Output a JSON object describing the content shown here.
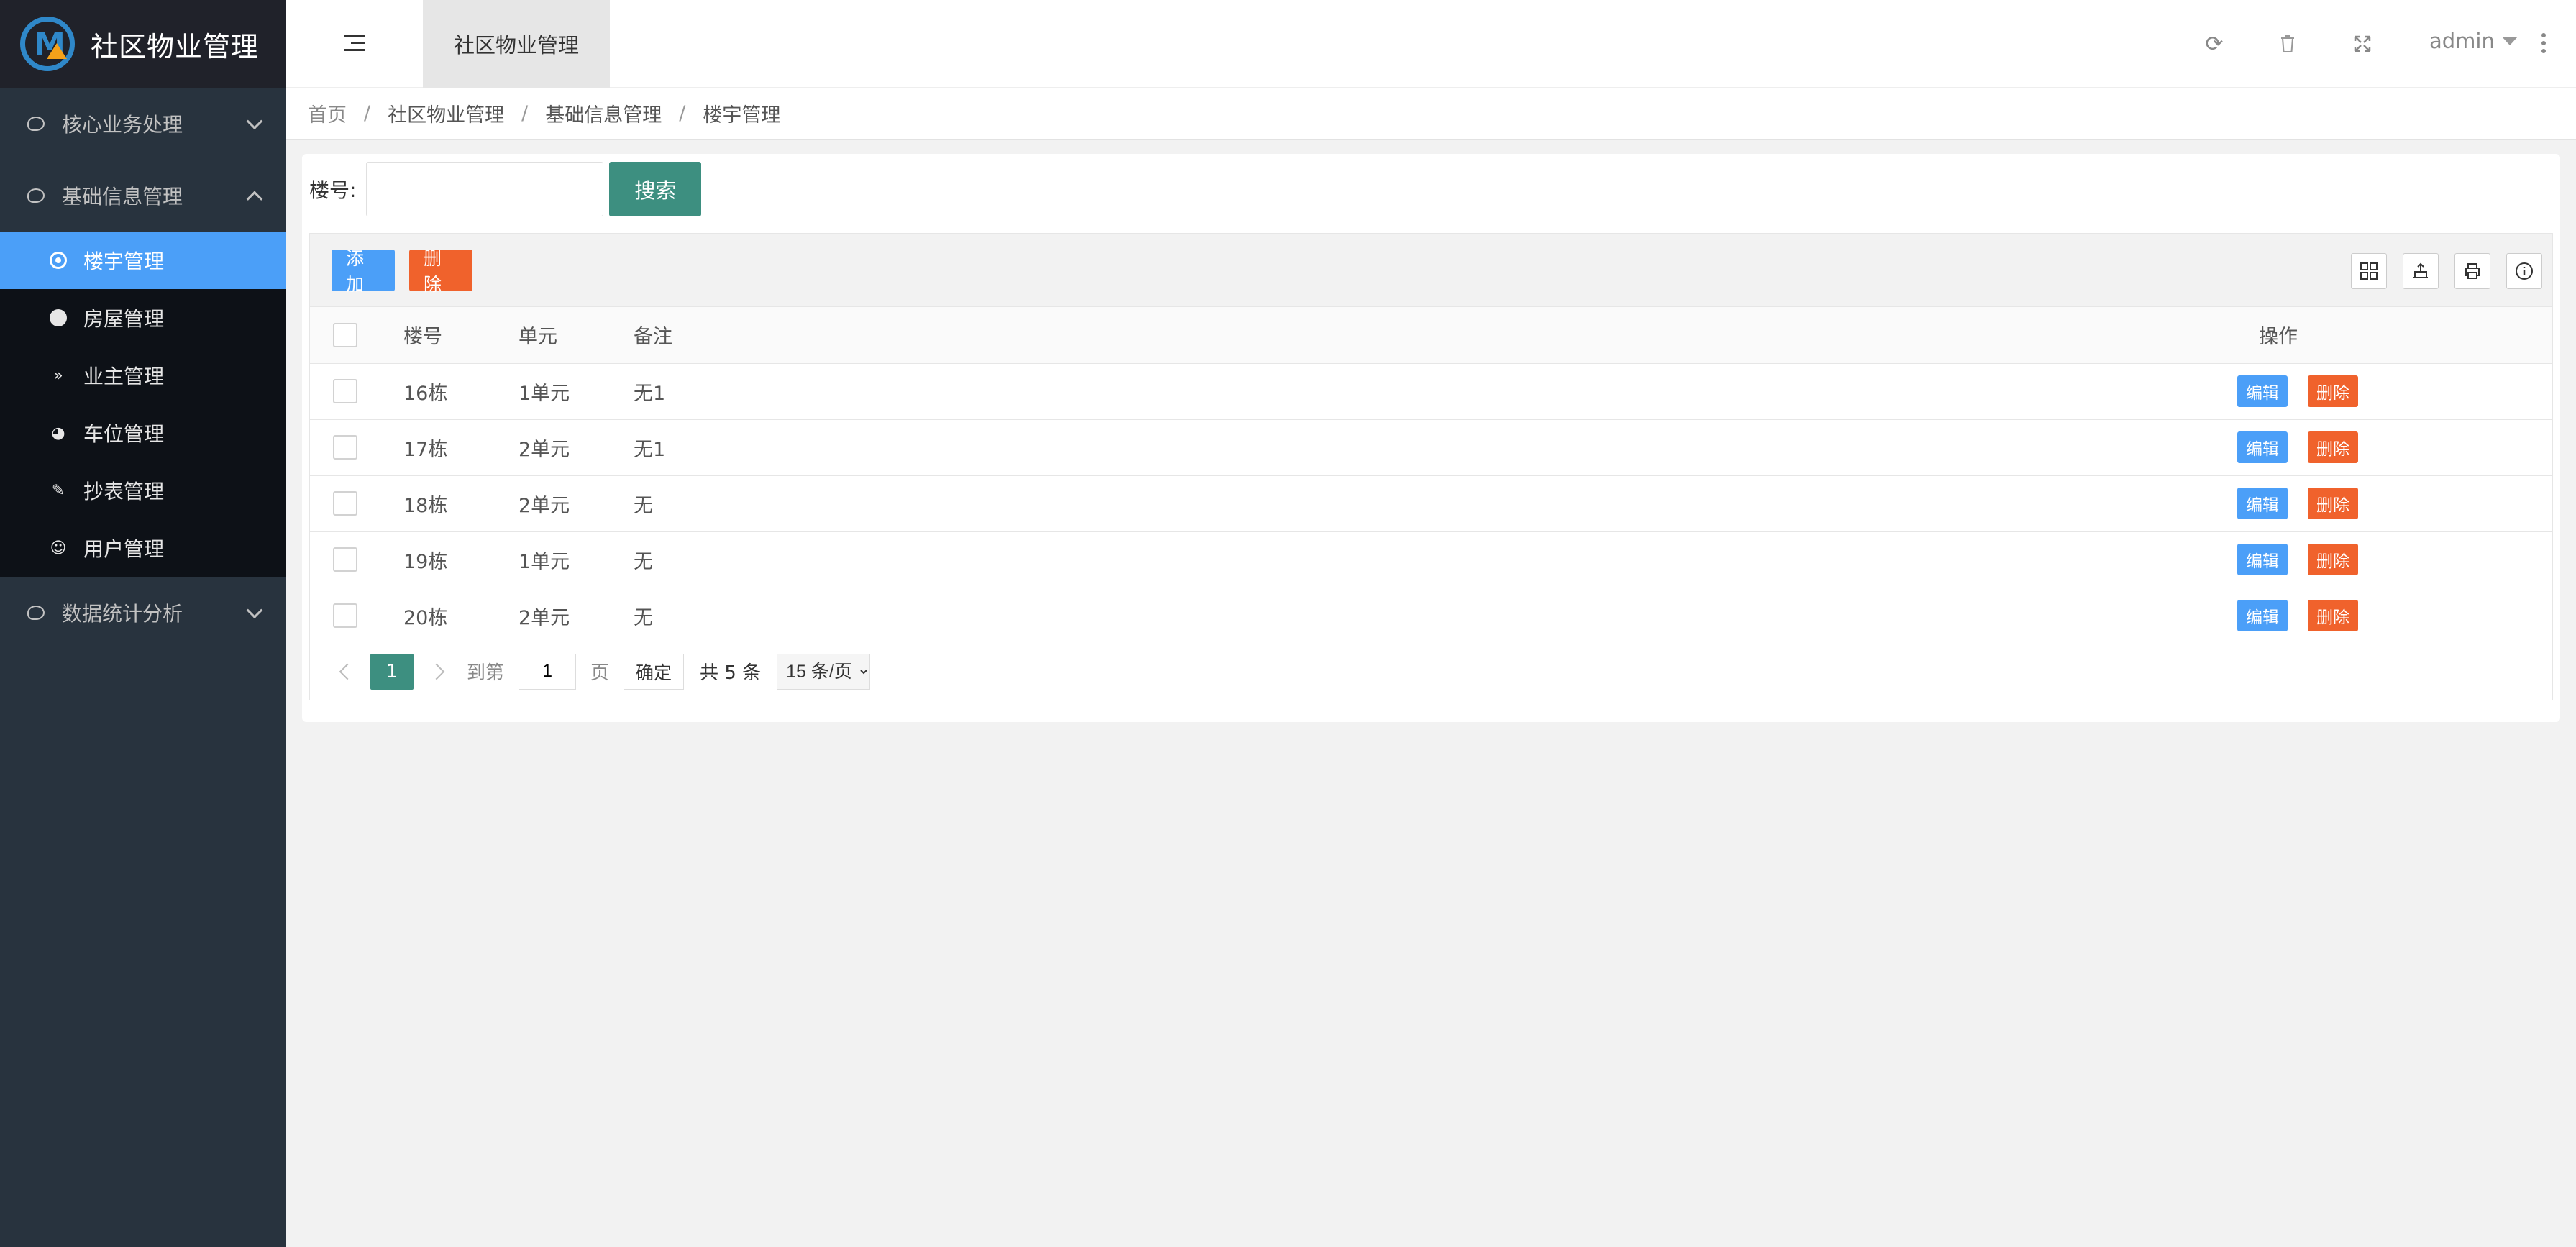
{
  "app": {
    "title": "社区物业管理"
  },
  "sidebar": {
    "groups": [
      {
        "label": "核心业务处理"
      },
      {
        "label": "基础信息管理"
      },
      {
        "label": "数据统计分析"
      }
    ],
    "items": [
      {
        "label": "楼宇管理",
        "icon": "target-icon"
      },
      {
        "label": "房屋管理",
        "icon": "home-circle-icon"
      },
      {
        "label": "业主管理",
        "icon": "double-chevron-icon"
      },
      {
        "label": "车位管理",
        "icon": "dashboard-icon"
      },
      {
        "label": "抄表管理",
        "icon": "edit-icon"
      },
      {
        "label": "用户管理",
        "icon": "user-circle-icon"
      }
    ],
    "active_color": "#4b9ff8"
  },
  "header": {
    "tab_label": "社区物业管理",
    "user": "admin"
  },
  "breadcrumb": [
    "首页",
    "社区物业管理",
    "基础信息管理",
    "楼宇管理"
  ],
  "search": {
    "label": "楼号:",
    "value": "",
    "button": "搜索"
  },
  "toolbar": {
    "add_label": "添加",
    "delete_label": "删除"
  },
  "table": {
    "columns": [
      "楼号",
      "单元",
      "备注",
      "操作"
    ],
    "rows": [
      {
        "building": "16栋",
        "unit": "1单元",
        "remark": "无1"
      },
      {
        "building": "17栋",
        "unit": "2单元",
        "remark": "无1"
      },
      {
        "building": "18栋",
        "unit": "2单元",
        "remark": "无"
      },
      {
        "building": "19栋",
        "unit": "1单元",
        "remark": "无"
      },
      {
        "building": "20栋",
        "unit": "2单元",
        "remark": "无"
      }
    ],
    "edit_label": "编辑",
    "remove_label": "删除"
  },
  "pagination": {
    "current": "1",
    "goto_label": "到第",
    "page_input": "1",
    "page_suffix": "页",
    "confirm": "确定",
    "total": "共 5 条",
    "page_size": "15 条/页"
  },
  "colors": {
    "primary": "#3d8f80",
    "blue": "#4b9ff8",
    "danger": "#f0622c",
    "sidebar_bg": "#28333e"
  }
}
